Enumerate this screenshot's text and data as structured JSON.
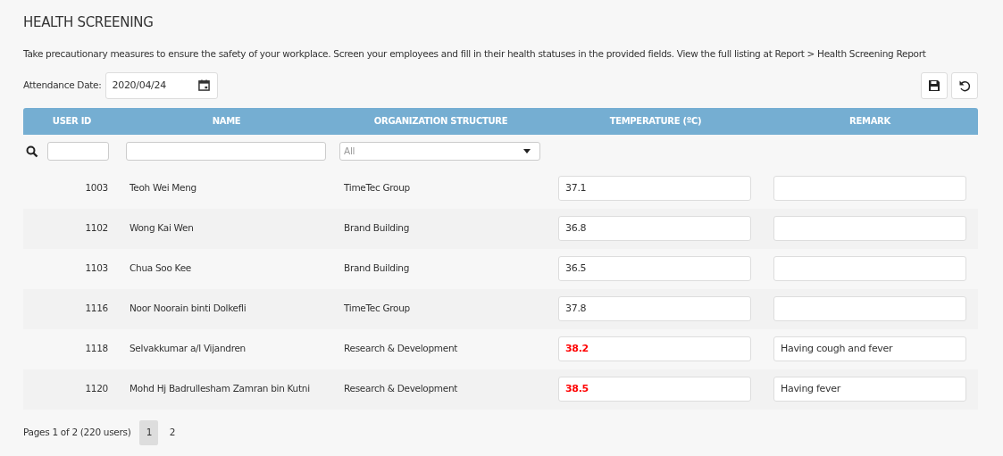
{
  "title": "HEALTH SCREENING",
  "description": "Take precautionary measures to ensure the safety of your workplace. Screen your employees and fill in their health statuses in the provided fields. View the full listing at Report > Health Screening Report",
  "attendance_date": {
    "label": "Attendance Date:",
    "value": "2020/04/24"
  },
  "table": {
    "columns": [
      "USER ID",
      "NAME",
      "ORGANIZATION STRUCTURE",
      "TEMPERATURE (ºC)",
      "REMARK"
    ],
    "filter": {
      "organization": "All"
    },
    "rows": [
      {
        "user_id": "1003",
        "name": "Teoh Wei Meng",
        "organization": "TimeTec Group",
        "temperature": "37.1",
        "fever": false
      },
      {
        "user_id": "1102",
        "name": "Wong Kai Wen",
        "organization": "Brand Building",
        "temperature": "36.8",
        "fever": false
      },
      {
        "user_id": "1103",
        "name": "Chua Soo Kee",
        "organization": "Brand Building",
        "temperature": "36.5",
        "fever": false
      },
      {
        "user_id": "1116",
        "name": "Noor Noorain binti Dolkefli",
        "organization": "TimeTec Group",
        "temperature": "37.8",
        "fever": false
      },
      {
        "user_id": "1118",
        "name": "Selvakkumar a/l Vijandren",
        "organization": "Research & Development",
        "temperature": "38.2",
        "fever": true,
        "remark": "Having cough and fever"
      },
      {
        "user_id": "1120",
        "name": "Mohd Hj Badrullesham Zamran bin Kutni",
        "organization": "Research & Development",
        "temperature": "38.5",
        "fever": true,
        "remark": "Having fever"
      }
    ]
  },
  "pagination": {
    "summary": "Pages 1 of 2 (220 users)",
    "pages": [
      {
        "label": "1",
        "selected": true
      },
      {
        "label": "2",
        "selected": false
      }
    ]
  }
}
